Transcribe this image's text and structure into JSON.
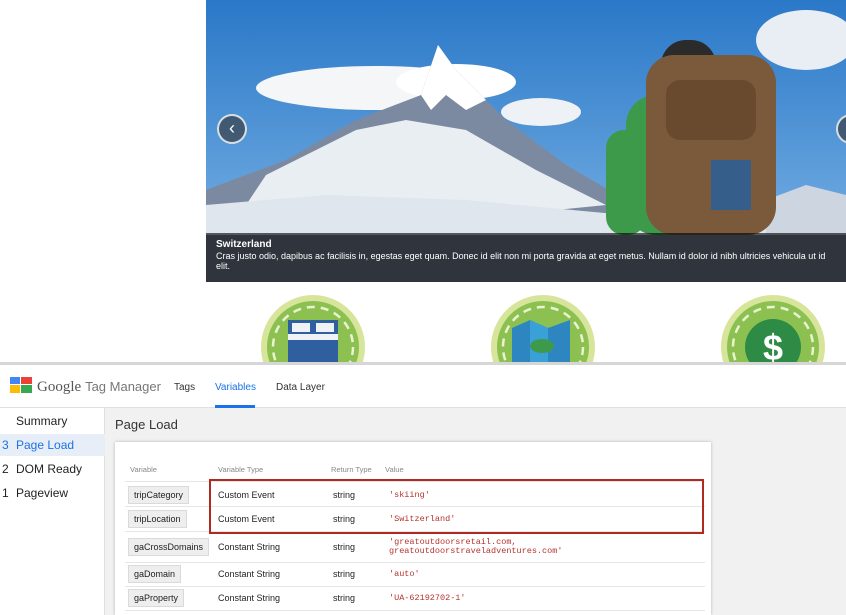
{
  "website": {
    "hero": {
      "title": "Switzerland",
      "text": "Cras justo odio, dapibus ac facilisis in, egestas eget quam. Donec id elit non mi porta gravida at eget metus. Nullam id dolor id nibh ultricies vehicula ut id elit."
    },
    "carousel": {
      "prev_label": "‹",
      "next_label": "›"
    },
    "badges": [
      "bed-icon",
      "map-icon",
      "dollar-icon"
    ],
    "badge_dollar_label": "$"
  },
  "gtm": {
    "brand_google": "Google",
    "brand_product": "Tag Manager",
    "tabs": [
      {
        "label": "Tags",
        "active": false
      },
      {
        "label": "Variables",
        "active": true
      },
      {
        "label": "Data Layer",
        "active": false
      }
    ],
    "sidebar": [
      {
        "num": "",
        "label": "Summary",
        "active": false
      },
      {
        "num": "3",
        "label": "Page Load",
        "active": true
      },
      {
        "num": "2",
        "label": "DOM Ready",
        "active": false
      },
      {
        "num": "1",
        "label": "Pageview",
        "active": false
      }
    ],
    "page_title": "Page Load",
    "table": {
      "headers": [
        "Variable",
        "Variable Type",
        "Return Type",
        "Value"
      ],
      "rows": [
        {
          "variable": "tripCategory",
          "type": "Custom Event",
          "return": "string",
          "value": "'skiing'",
          "value2": ""
        },
        {
          "variable": "tripLocation",
          "type": "Custom Event",
          "return": "string",
          "value": "'Switzerland'",
          "value2": ""
        },
        {
          "variable": "gaCrossDomains",
          "type": "Constant String",
          "return": "string",
          "value": "'greatoutdoorsretail.com,",
          "value2": "greatoutdoorstraveladventures.com'"
        },
        {
          "variable": "gaDomain",
          "type": "Constant String",
          "return": "string",
          "value": "'auto'",
          "value2": ""
        },
        {
          "variable": "gaProperty",
          "type": "Constant String",
          "return": "string",
          "value": "'UA-62192702-1'",
          "value2": ""
        }
      ]
    },
    "colors": {
      "accent": "#1a73e8",
      "value_text": "#b5332e",
      "highlight": "#b02a22"
    }
  }
}
